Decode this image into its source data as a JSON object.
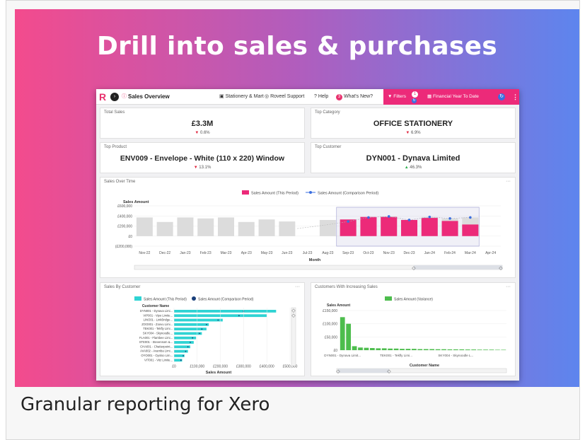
{
  "headline": "Drill into sales & purchases",
  "caption": "Granular reporting for Xero",
  "colors": {
    "pink": "#ec2a79",
    "teal": "#2fd3d3",
    "green": "#4dbd4d",
    "grey_bar": "#dcdcdc",
    "navy": "#1a3f7a"
  },
  "topbar": {
    "logo": "R",
    "nav_icon": "chevron-right-icon",
    "page_title": "Sales Overview",
    "company": "Stationery & Mart",
    "support": "Roveel Support",
    "help": "Help",
    "whats_new_count": "3",
    "whats_new": "What's New?",
    "filters": "Filters",
    "filters_badge": "1",
    "date_range": "Financial Year To Date"
  },
  "kpis": {
    "total_sales": {
      "title": "Total Sales",
      "value": "£3.3M",
      "delta": "0.6%",
      "direction": "down"
    },
    "top_category": {
      "title": "Top Category",
      "value": "OFFICE STATIONERY",
      "delta": "6.9%",
      "direction": "down"
    },
    "top_product": {
      "title": "Top Product",
      "value": "ENV009 - Envelope - White (110 x 220) Window",
      "delta": "13.1%",
      "direction": "down"
    },
    "top_customer": {
      "title": "Top Customer",
      "value": "DYN001 - Dynava Limited",
      "delta": "46.3%",
      "direction": "up"
    }
  },
  "sales_over_time": {
    "title": "Sales Over Time",
    "menu": "···",
    "legend_this": "Sales Amount (This Period)",
    "legend_comp": "Sales Amount (Comparison Period)",
    "xlabel": "Month"
  },
  "sales_by_customer": {
    "title": "Sales By Customer",
    "menu": "···",
    "legend_this": "Sales Amount (This Period)",
    "legend_comp": "Sales Amount (Comparison Period)"
  },
  "customers_increasing": {
    "title": "Customers With Increasing Sales",
    "menu": "···",
    "legend": "Sales Amount (Variance)"
  },
  "chart_data": [
    {
      "type": "bar",
      "title": "Sales Over Time",
      "ylabel": "Sales Amount",
      "xlabel": "Month",
      "ylim": [
        -200000,
        600000
      ],
      "yticks": [
        "£600,000",
        "£400,000",
        "£200,000",
        "£0",
        "(£200,000)"
      ],
      "categories": [
        "Nov-22",
        "Dec-22",
        "Jan-23",
        "Feb-23",
        "Mar-23",
        "Apr-23",
        "May-23",
        "Jun-23",
        "Jul-23",
        "Aug-23",
        "Sep-23",
        "Oct-23",
        "Nov-23",
        "Dec-23",
        "Jan-24",
        "Feb-24",
        "Mar-24",
        "Apr-24"
      ],
      "series": [
        {
          "name": "Sales Amount (This Period)",
          "values": [
            0,
            0,
            0,
            0,
            0,
            0,
            0,
            0,
            0,
            0,
            330000,
            380000,
            380000,
            320000,
            360000,
            300000,
            230000,
            0
          ]
        },
        {
          "name": "Sales Amount (Comparison Period)",
          "values": [
            370000,
            280000,
            370000,
            350000,
            370000,
            280000,
            330000,
            290000,
            0,
            320000,
            290000,
            370000,
            390000,
            320000,
            380000,
            350000,
            370000,
            0
          ]
        }
      ]
    },
    {
      "type": "bar",
      "title": "Sales By Customer",
      "xlabel": "Sales Amount",
      "ylabel": "Customer Name",
      "xlim": [
        0,
        500000
      ],
      "xticks": [
        "£0",
        "£100,000",
        "£200,000",
        "£300,000",
        "£400,000",
        "£500,000"
      ],
      "categories": [
        "DYN001 - Dynava Limi...",
        "VIP001 - Vipo Limite...",
        "LINO01 - LinkBridge...",
        "ZOO001 - Zoovu Limi...",
        "TEK001 - Tekfly Limi...",
        "SKY004 - Skynoodle...",
        "FLA001 - Flambee Limi...",
        "STE001 - Stevensom &...",
        "CHA001 - Chatterpoint...",
        "AVA002 - Avamba Limi...",
        "OYO001 - Oyoloo Lim...",
        "VIT001 - Vitz Limite..."
      ],
      "series": [
        {
          "name": "Sales Amount (This Period)",
          "values": [
            440000,
            400000,
            210000,
            150000,
            140000,
            120000,
            95000,
            85000,
            70000,
            60000,
            45000,
            35000
          ]
        },
        {
          "name": "Sales Amount (Comparison Period)",
          "values": [
            300000,
            280000,
            190000,
            140000,
            120000,
            110000,
            80000,
            70000,
            60000,
            50000,
            40000,
            30000
          ]
        }
      ]
    },
    {
      "type": "bar",
      "title": "Customers With Increasing Sales",
      "ylabel": "Sales Amount",
      "xlabel": "Customer Name",
      "ylim": [
        0,
        150000
      ],
      "yticks": [
        "£150,000",
        "£100,000",
        "£50,000",
        "£0"
      ],
      "tick_labels": [
        "DYN001 - Dynava Limit...",
        "TEK001 - Tekfly Limi...",
        "SKY004 - Skynoodle L..."
      ],
      "series": [
        {
          "name": "Sales Amount (Variance)",
          "values": [
            125000,
            100000,
            15000,
            10000,
            9000,
            8000,
            7000,
            7000,
            6000,
            6000,
            5000,
            5000,
            5000,
            4000,
            4000,
            4000,
            3500,
            3500,
            3000,
            3000,
            3000,
            2500,
            2500,
            2000,
            2000,
            2000,
            1500,
            1500
          ]
        }
      ]
    }
  ]
}
